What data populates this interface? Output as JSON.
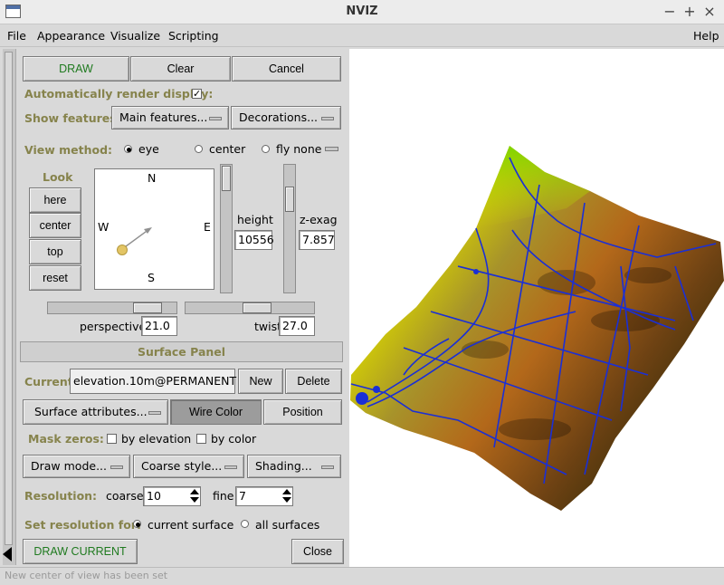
{
  "window": {
    "title": "NVIZ",
    "minimize": "−",
    "maximize": "+",
    "close": "×"
  },
  "menu": {
    "file": "File",
    "appearance": "Appearance",
    "visualize": "Visualize",
    "scripting": "Scripting",
    "help": "Help"
  },
  "toolbar": {
    "draw": "DRAW",
    "clear": "Clear",
    "cancel": "Cancel"
  },
  "auto_render": {
    "label": "Automatically render display:",
    "checked": true,
    "mark": "✓"
  },
  "show_features": {
    "label": "Show features:",
    "main": "Main features...",
    "decorations": "Decorations..."
  },
  "view_method": {
    "label": "View method:",
    "eye": "eye",
    "center": "center",
    "fly": "fly none",
    "selected": "eye"
  },
  "look": {
    "label": "Look",
    "here": "here",
    "center": "center",
    "top": "top",
    "reset": "reset",
    "compass": {
      "n": "N",
      "s": "S",
      "e": "E",
      "w": "W"
    }
  },
  "height": {
    "label": "height",
    "value": "10556"
  },
  "zexag": {
    "label": "z-exag",
    "value": "7.857"
  },
  "perspective": {
    "label": "perspective",
    "value": "21.0"
  },
  "twist": {
    "label": "twist",
    "value": "27.0"
  },
  "surface_panel": {
    "title": "Surface Panel",
    "current_label": "Current:",
    "current_value": "elevation.10m@PERMANENT",
    "new": "New",
    "delete": "Delete",
    "attributes": "Surface attributes...",
    "wire_color": "Wire Color",
    "position": "Position",
    "mask_label": "Mask zeros:",
    "mask_elevation": "by elevation",
    "mask_color": "by color",
    "draw_mode": "Draw mode...",
    "coarse_style": "Coarse style...",
    "shading": "Shading...",
    "resolution_label": "Resolution:",
    "coarse_label": "coarse",
    "coarse_value": "10",
    "fine_label": "fine",
    "fine_value": "7",
    "set_res_label": "Set resolution for:",
    "current_surface": "current surface",
    "all_surfaces": "all surfaces",
    "draw_current": "DRAW CURRENT",
    "close": "Close"
  },
  "colors": {
    "accent_olive": "#86834c",
    "draw_green": "#1f7a1f",
    "road_blue": "#1a2fd6"
  },
  "status": {
    "text": "New center of view has been set"
  }
}
